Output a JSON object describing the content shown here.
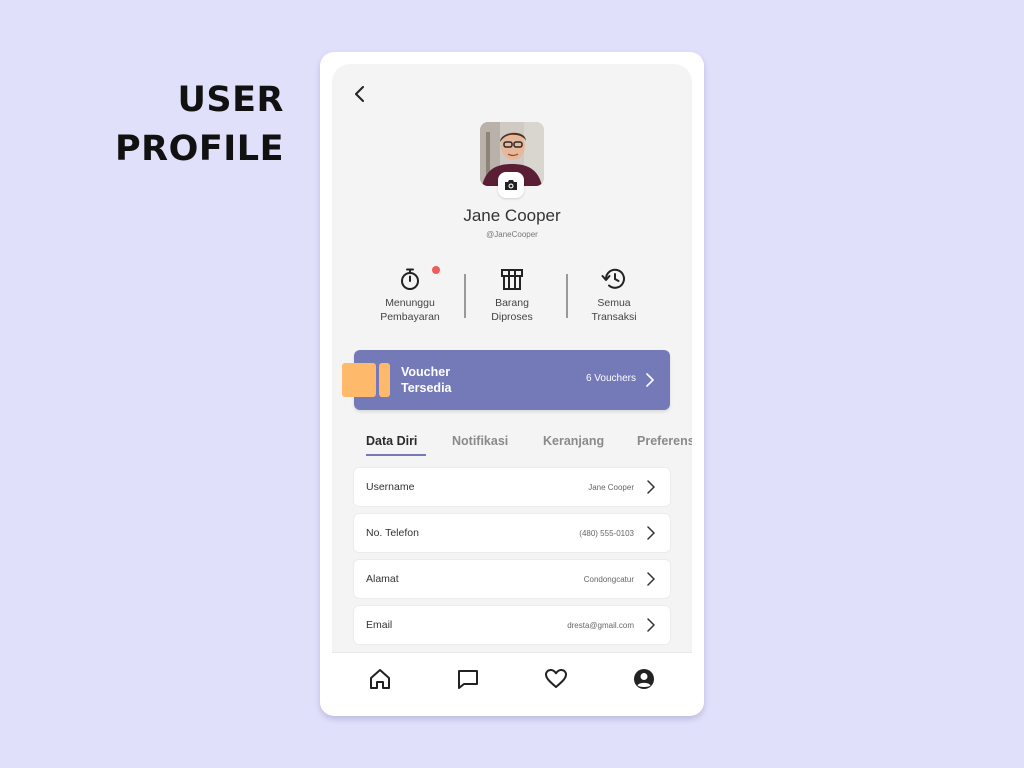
{
  "page_heading": {
    "line1": "USER",
    "line2": "PROFILE"
  },
  "profile": {
    "name": "Jane Cooper",
    "handle": "@JaneCooper"
  },
  "status": [
    {
      "label_line1": "Menunggu",
      "label_line2": "Pembayaran",
      "icon": "stopwatch-icon",
      "has_notification": true
    },
    {
      "label_line1": "Barang",
      "label_line2": "Diproses",
      "icon": "gift-box-icon"
    },
    {
      "label_line1": "Semua",
      "label_line2": "Transaksi",
      "icon": "history-icon"
    }
  ],
  "voucher": {
    "title_line1": "Voucher",
    "title_line2": "Tersedia",
    "count": "6 Vouchers"
  },
  "tabs": [
    {
      "label": "Data Diri",
      "active": true
    },
    {
      "label": "Notifikasi"
    },
    {
      "label": "Keranjang"
    },
    {
      "label": "Preferensi"
    }
  ],
  "fields": [
    {
      "label": "Username",
      "value": "Jane Cooper"
    },
    {
      "label": "No. Telefon",
      "value": "(480) 555-0103"
    },
    {
      "label": "Alamat",
      "value": "Condongcatur"
    },
    {
      "label": "Email",
      "value": "dresta@gmail.com"
    }
  ],
  "nav": [
    "home-icon",
    "chat-icon",
    "heart-icon",
    "profile-icon"
  ],
  "colors": {
    "background": "#e0e0fb",
    "accent": "#7479b8",
    "ticket": "#ffb96a",
    "notification": "#f05b5b"
  }
}
